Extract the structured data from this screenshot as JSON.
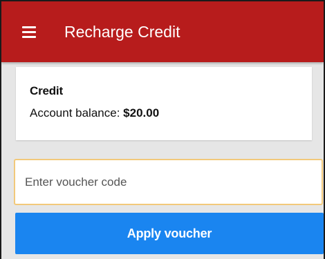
{
  "appbar": {
    "title": "Recharge Credit",
    "menu_icon": "menu-icon",
    "color": "#b71c1c"
  },
  "credit_card": {
    "title": "Credit",
    "balance_label": "Account balance:",
    "balance_value": "$20.00"
  },
  "voucher": {
    "placeholder": "Enter voucher code",
    "value": "",
    "border_color": "#f2c97a"
  },
  "apply_button": {
    "label": "Apply voucher",
    "color": "#1a85f0"
  }
}
